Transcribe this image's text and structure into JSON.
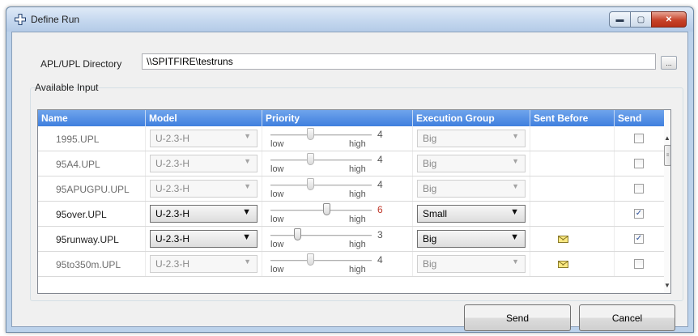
{
  "window": {
    "title": "Define Run",
    "minimize_glyph": "▬",
    "maximize_glyph": "▢",
    "close_glyph": "✕"
  },
  "directory": {
    "label": "APL/UPL Directory",
    "value": "\\\\SPITFIRE\\testruns",
    "browse_label": "..."
  },
  "available_input": {
    "label": "Available Input",
    "columns": [
      "Name",
      "Model",
      "Priority",
      "Execution Group",
      "Sent Before",
      "Send"
    ],
    "priority_low_label": "low",
    "priority_high_label": "high",
    "rows": [
      {
        "name": "1995.UPL",
        "model": "U-2.3-H",
        "priority": "4",
        "priority_level": 0.5,
        "exec_group": "Big",
        "sent_before": false,
        "send": false,
        "enabled": false
      },
      {
        "name": "95A4.UPL",
        "model": "U-2.3-H",
        "priority": "4",
        "priority_level": 0.5,
        "exec_group": "Big",
        "sent_before": false,
        "send": false,
        "enabled": false
      },
      {
        "name": "95APUGPU.UPL",
        "model": "U-2.3-H",
        "priority": "4",
        "priority_level": 0.5,
        "exec_group": "Big",
        "sent_before": false,
        "send": false,
        "enabled": false
      },
      {
        "name": "95over.UPL",
        "model": "U-2.3-H",
        "priority": "6",
        "priority_level": 0.75,
        "exec_group": "Small",
        "sent_before": false,
        "send": true,
        "enabled": true,
        "priority_highlight": true
      },
      {
        "name": "95runway.UPL",
        "model": "U-2.3-H",
        "priority": "3",
        "priority_level": 0.3,
        "exec_group": "Big",
        "sent_before": true,
        "send": true,
        "enabled": true
      },
      {
        "name": "95to350m.UPL",
        "model": "U-2.3-H",
        "priority": "4",
        "priority_level": 0.5,
        "exec_group": "Big",
        "sent_before": true,
        "send": false,
        "enabled": false
      }
    ]
  },
  "icons": {
    "app": "plus-cross-icon",
    "dropdown": "chevron-down-icon",
    "sent_before": "envelope-icon",
    "checkmark": "✓"
  },
  "colors": {
    "header_blue": "#4d8be3",
    "priority_highlight": "#c0392b"
  },
  "buttons": {
    "send_label": "Send",
    "cancel_label": "Cancel"
  }
}
